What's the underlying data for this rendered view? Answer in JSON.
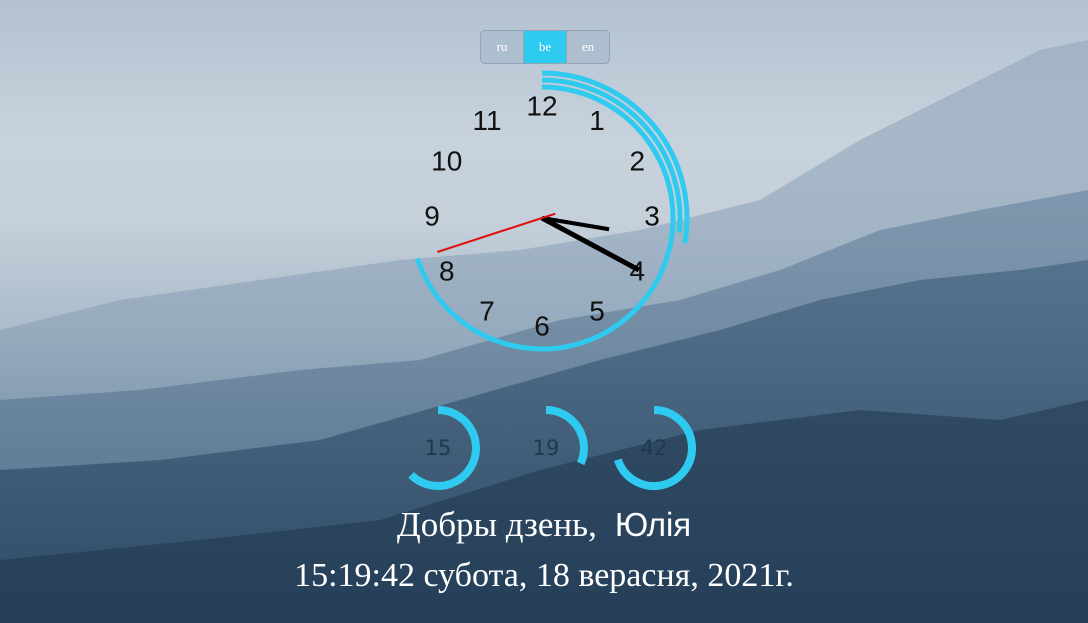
{
  "languages": {
    "options": [
      "ru",
      "be",
      "en"
    ],
    "active": "be"
  },
  "colors": {
    "accent": "#2fcaf0",
    "second_hand": "#e01010",
    "hands": "#000000"
  },
  "clock": {
    "numbers": [
      "12",
      "1",
      "2",
      "3",
      "4",
      "5",
      "6",
      "7",
      "8",
      "9",
      "10",
      "11"
    ],
    "hours": 15,
    "minutes": 19,
    "seconds": 42
  },
  "rings": [
    {
      "label": "15",
      "value": 15,
      "max": 24
    },
    {
      "label": "19",
      "value": 19,
      "max": 60
    },
    {
      "label": "42",
      "value": 42,
      "max": 60
    }
  ],
  "greeting": {
    "text": "Добры дзень,",
    "name": "Юлія"
  },
  "datetime": {
    "text": "15:19:42 субота, 18 верасня, 2021г."
  }
}
